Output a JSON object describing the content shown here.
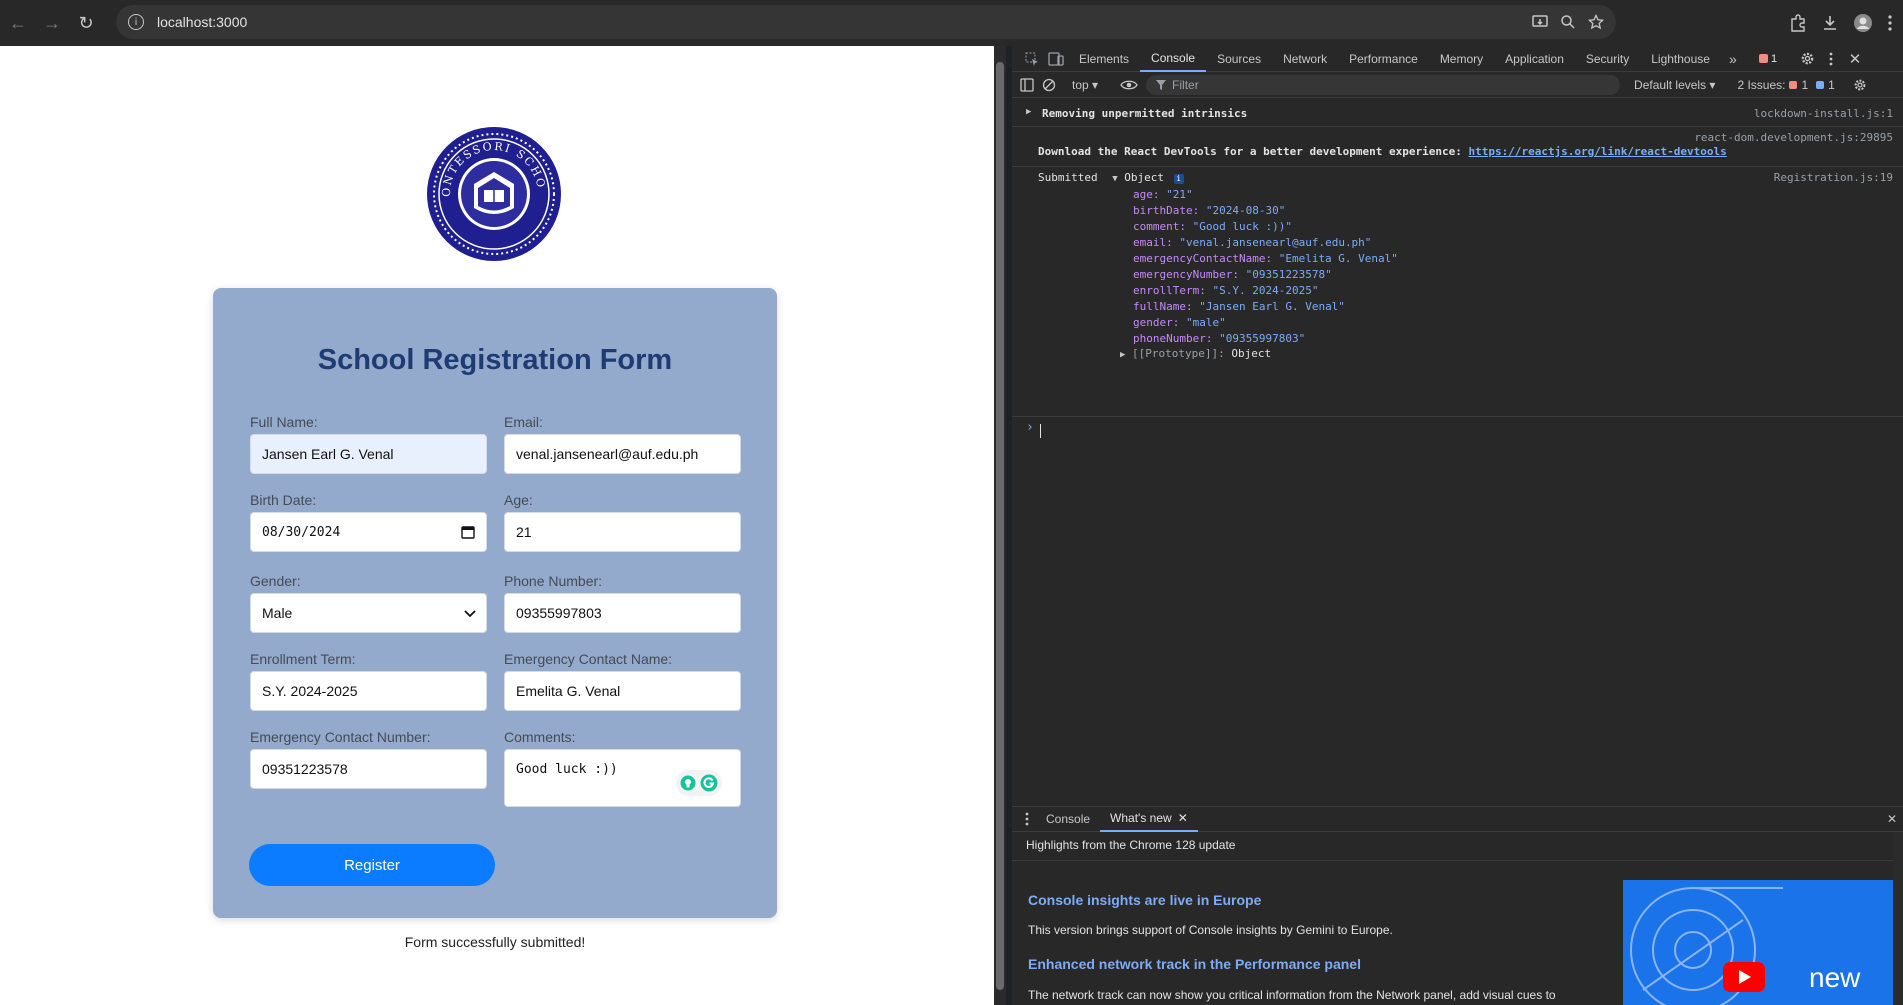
{
  "browser": {
    "url": "localhost:3000"
  },
  "form": {
    "title": "School Registration Form",
    "fields": {
      "full_name": {
        "label": "Full Name:",
        "value": "Jansen Earl G. Venal"
      },
      "email": {
        "label": "Email:",
        "value": "venal.jansenearl@auf.edu.ph"
      },
      "birth_date": {
        "label": "Birth Date:",
        "value": "08/30/2024"
      },
      "age": {
        "label": "Age:",
        "value": "21"
      },
      "gender": {
        "label": "Gender:",
        "value": "Male"
      },
      "phone": {
        "label": "Phone Number:",
        "value": "09355997803"
      },
      "enroll_term": {
        "label": "Enrollment Term:",
        "value": "S.Y. 2024-2025"
      },
      "emergency_name": {
        "label": "Emergency Contact Name:",
        "value": "Emelita G. Venal"
      },
      "emergency_number": {
        "label": "Emergency Contact Number:",
        "value": "09351223578"
      },
      "comments": {
        "label": "Comments:",
        "value": "Good luck :))"
      }
    },
    "register_label": "Register",
    "success_message": "Form successfully submitted!"
  },
  "devtools": {
    "tabs": [
      "Elements",
      "Console",
      "Sources",
      "Network",
      "Performance",
      "Memory",
      "Application",
      "Security",
      "Lighthouse"
    ],
    "active_tab": "Console",
    "error_count": "1",
    "context": "top",
    "filter_placeholder": "Filter",
    "levels": "Default levels",
    "issues_label": "2 Issues:",
    "issues_errors": "1",
    "issues_info": "1",
    "console": {
      "line1": {
        "text": "Removing unpermitted intrinsics",
        "source": "lockdown-install.js:1"
      },
      "line2": {
        "source": "react-dom.development.js:29895",
        "text": "Download the React DevTools for a better development experience: ",
        "link": "https://reactjs.org/link/react-devtools"
      },
      "line3": {
        "label": "Submitted",
        "object": "Object",
        "source": "Registration.js:19"
      },
      "props": [
        {
          "key": "age",
          "value": "\"21\""
        },
        {
          "key": "birthDate",
          "value": "\"2024-08-30\""
        },
        {
          "key": "comment",
          "value": "\"Good luck :))\""
        },
        {
          "key": "email",
          "value": "\"venal.jansenearl@auf.edu.ph\""
        },
        {
          "key": "emergencyContactName",
          "value": "\"Emelita G. Venal\""
        },
        {
          "key": "emergencyNumber",
          "value": "\"09351223578\""
        },
        {
          "key": "enrollTerm",
          "value": "\"S.Y. 2024-2025\""
        },
        {
          "key": "fullName",
          "value": "\"Jansen Earl G. Venal\""
        },
        {
          "key": "gender",
          "value": "\"male\""
        },
        {
          "key": "phoneNumber",
          "value": "\"09355997803\""
        }
      ],
      "prototype_key": "[[Prototype]]",
      "prototype_value": "Object"
    },
    "drawer": {
      "tabs": [
        "Console",
        "What's new"
      ],
      "headline": "Highlights from the Chrome 128 update",
      "item1_title": "Console insights are live in Europe",
      "item1_text": "This version brings support of Console insights by Gemini to Europe.",
      "item2_title": "Enhanced network track in the Performance panel",
      "item2_text": "The network track can now show you critical information from the Network panel, add visual cues to",
      "image_word": "new"
    }
  }
}
